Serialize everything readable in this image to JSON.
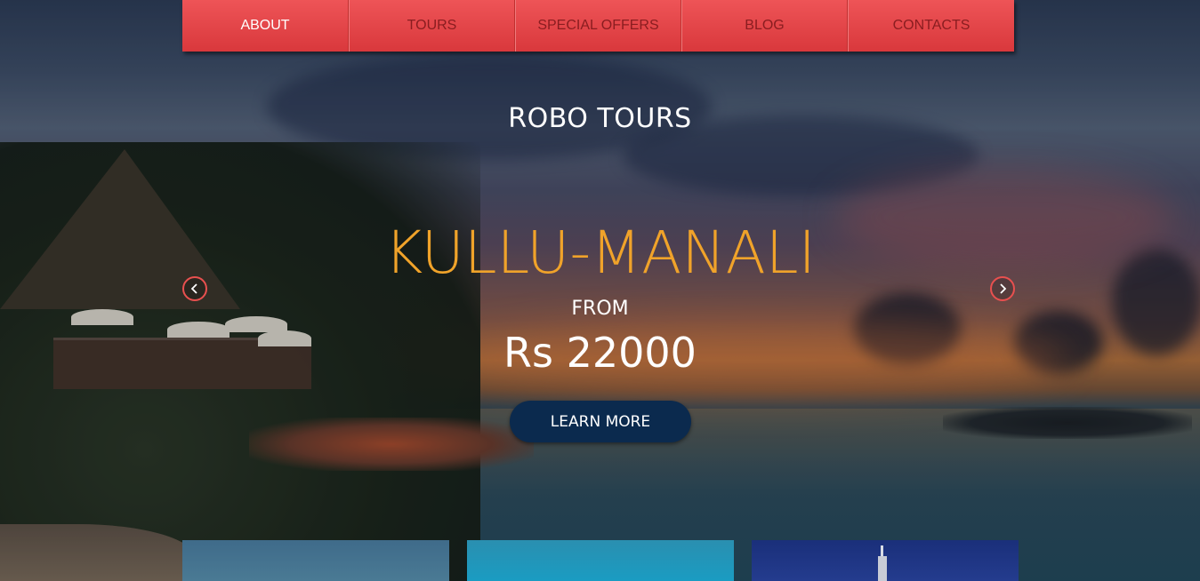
{
  "nav": {
    "items": [
      {
        "label": "ABOUT",
        "active": true
      },
      {
        "label": "TOURS",
        "active": false
      },
      {
        "label": "SPECIAL OFFERS",
        "active": false
      },
      {
        "label": "BLOG",
        "active": false
      },
      {
        "label": "CONTACTS",
        "active": false
      }
    ]
  },
  "hero": {
    "brand": "ROBO TOURS",
    "destination": "KULLU-MANALI",
    "from_label": "FROM",
    "price": "Rs 22000",
    "cta_label": "LEARN MORE",
    "prev_icon": "chevron-left-icon",
    "next_icon": "chevron-right-icon"
  },
  "colors": {
    "nav_background": "#e44a4d",
    "nav_text": "#8a1d20",
    "nav_active_text": "#ffffff",
    "destination_text": "#f0a32a",
    "cta_background": "#0b2a4e",
    "arrow_border": "#e8504f"
  }
}
